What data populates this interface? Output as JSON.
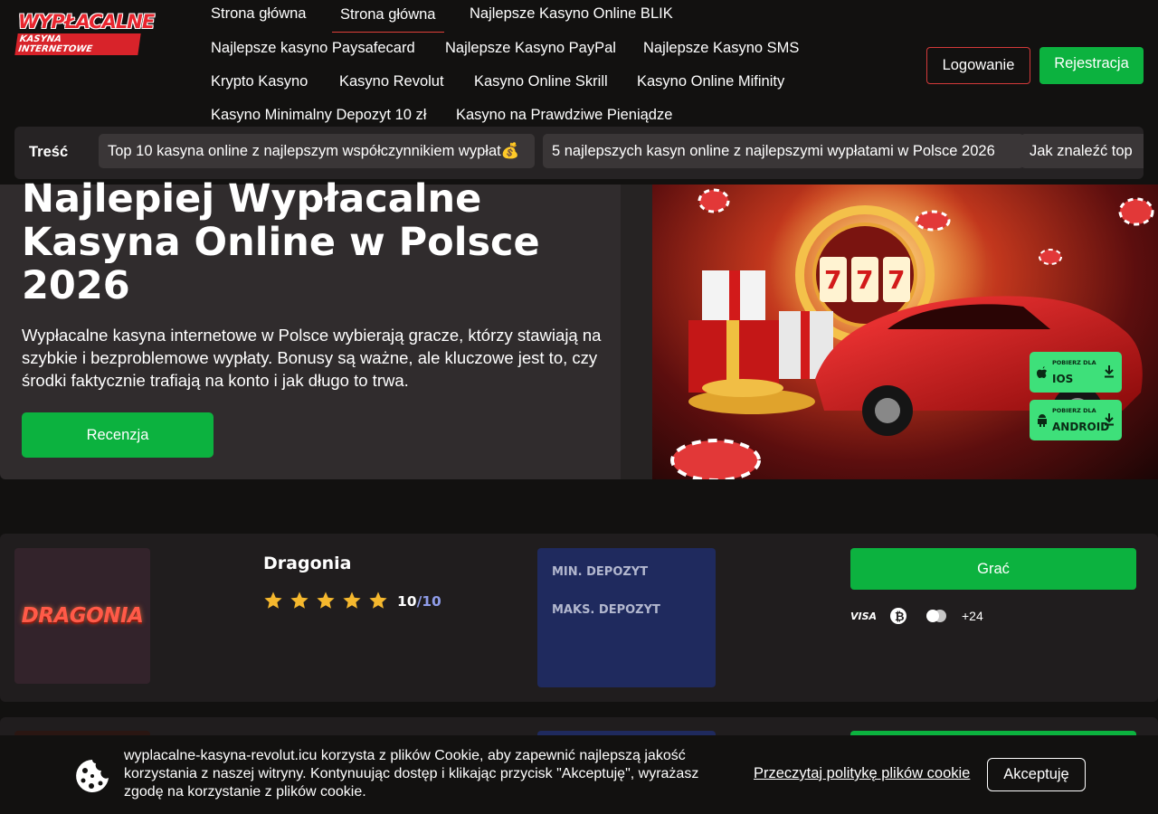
{
  "logo": {
    "line1": "WYPŁACALNE",
    "line2": "KASYNA INTERNETOWE"
  },
  "nav": {
    "items": [
      "Strona główna",
      "Strona główna",
      "Najlepsze Kasyno Online BLIK",
      "Najlepsze kasyno Paysafecard",
      "Najlepsze Kasyno PayPal",
      "Najlepsze Kasyno SMS",
      "Krypto Kasyno",
      "Kasyno Revolut",
      "Kasyno Online Skrill",
      "Kasyno Online Mifinity",
      "Kasyno Minimalny Depozyt 10 zł",
      "Kasyno na Prawdziwe Pieniądze"
    ],
    "active_index": 1
  },
  "auth": {
    "login": "Logowanie",
    "register": "Rejestracja"
  },
  "toc": {
    "label": "Treść",
    "chips": [
      "Top 10 kasyna online z najlepszym współczynnikiem wypłat💰",
      "5 najlepszych kasyn online z najlepszymi wypłatami w Polsce 2026",
      "Jak znaleźć top"
    ]
  },
  "hero": {
    "title": "Najlepiej Wypłacalne Kasyna Online w Polsce 2026",
    "description": "Wypłacalne kasyna internetowe w Polsce wybierają gracze, którzy stawiają na szybkie i bezproblemowe wypłaty. Bonusy są ważne, ale kluczowe jest to, czy środki faktycznie trafiają na konto i jak długo to trwa.",
    "review_button": "Recenzja",
    "app_ios": {
      "small": "POBIERZ DLA",
      "big": "IOS"
    },
    "app_android": {
      "small": "POBIERZ DLA",
      "big": "ANDROID"
    }
  },
  "casino": {
    "logo_text": "DRAGONIA",
    "name": "Dragonia",
    "stars": 5,
    "rating": "10",
    "rating_max": "/10",
    "min_deposit_label": "MIN. DEPOZYT",
    "max_deposit_label": "MAKS. DEPOZYT",
    "play_button": "Grać",
    "payment_icons": [
      "visa-icon",
      "bitcoin-icon",
      "mastercard-icon"
    ],
    "visa_text": "VISA",
    "payment_more": "+24"
  },
  "cookie": {
    "text": "wyplacalne-kasyna-revolut.icu korzysta z plików Cookie, aby zapewnić najlepszą jakość korzystania z naszej witryny. Kontynuując dostęp i klikając przycisk \"Akceptuję\", wyrażasz zgodę na korzystanie z plików cookie.",
    "policy_link": "Przeczytaj politykę plików cookie",
    "accept": "Akceptuję"
  },
  "colors": {
    "accent_green": "#0cb23f",
    "accent_red": "#d33a3a",
    "deposit_blue": "#1f2a5e",
    "star": "#f5b82e"
  }
}
